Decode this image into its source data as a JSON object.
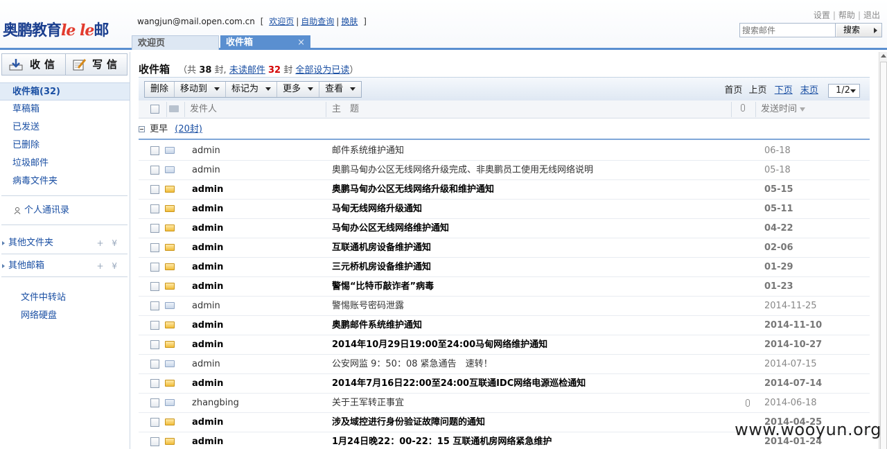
{
  "header": {
    "logo_main": "奥鹏教育",
    "logo_lele": "le le",
    "logo_suffix": "邮",
    "user_email": "wangjun@mail.open.com.cn",
    "links": {
      "welcome": "欢迎页",
      "self_query": "自助查询",
      "change_skin": "换肤"
    },
    "top_links": {
      "settings": "设置",
      "help": "帮助",
      "logout": "退出"
    },
    "search_placeholder": "搜索邮件",
    "search_button": "搜索"
  },
  "tabs": {
    "welcome": "欢迎页",
    "inbox": "收件箱",
    "close": "×"
  },
  "sidebar": {
    "receive": "收信",
    "write": "写信",
    "folders": [
      "收件箱(32)",
      "草稿箱",
      "已发送",
      "已删除",
      "垃圾邮件",
      "病毒文件夹"
    ],
    "contacts": "个人通讯录",
    "other_folders": "其他文件夹",
    "other_mailboxes": "其他邮箱",
    "group_actions": "+ ¥",
    "transfer": "文件中转站",
    "netdisk": "网络硬盘"
  },
  "list": {
    "title": "收件箱",
    "total_prefix": "（共",
    "total": "38",
    "total_unit": "封,",
    "unread_link": "未读邮件",
    "unread_count": "32",
    "unread_unit": "封",
    "mark_all": "全部设为已读",
    "close_paren": "）"
  },
  "toolbar": {
    "delete": "删除",
    "move_to": "移动到",
    "mark_as": "标记为",
    "more": "更多",
    "view": "查看",
    "pager_first": "首页",
    "pager_prev": "上页",
    "pager_next": "下页",
    "pager_last": "末页",
    "page_value": "1/2"
  },
  "columns": {
    "sender": "发件人",
    "subject": "主　题",
    "date": "发送时间"
  },
  "group": {
    "label": "更早",
    "count": "(20封)"
  },
  "colors": {
    "accent": "#5a8fd0",
    "link": "#1a4fa3",
    "unread_count": "#d40000"
  },
  "emails": [
    {
      "sender": "admin",
      "subject": "邮件系统维护通知",
      "date": "06-18",
      "unread": false,
      "attachment": false
    },
    {
      "sender": "admin",
      "subject": "奥鹏马甸办公区无线网络升级完成、非奥鹏员工使用无线网络说明",
      "date": "05-18",
      "unread": false,
      "attachment": false
    },
    {
      "sender": "admin",
      "subject": "奥鹏马甸办公区无线网络升级和维护通知",
      "date": "05-15",
      "unread": true,
      "attachment": false
    },
    {
      "sender": "admin",
      "subject": "马甸无线网络升级通知",
      "date": "05-11",
      "unread": true,
      "attachment": false
    },
    {
      "sender": "admin",
      "subject": "马甸办公区无线网络维护通知",
      "date": "04-22",
      "unread": true,
      "attachment": false
    },
    {
      "sender": "admin",
      "subject": "互联通机房设备维护通知",
      "date": "02-06",
      "unread": true,
      "attachment": false
    },
    {
      "sender": "admin",
      "subject": "三元桥机房设备维护通知",
      "date": "01-29",
      "unread": true,
      "attachment": false
    },
    {
      "sender": "admin",
      "subject": "警惕“比特币敲诈者”病毒",
      "date": "01-23",
      "unread": true,
      "attachment": false
    },
    {
      "sender": "admin",
      "subject": "警惕账号密码泄露",
      "date": "2014-11-25",
      "unread": false,
      "attachment": false
    },
    {
      "sender": "admin",
      "subject": "奥鹏邮件系统维护通知",
      "date": "2014-11-10",
      "unread": true,
      "attachment": false
    },
    {
      "sender": "admin",
      "subject": "2014年10月29日19:00至24:00马甸网络维护通知",
      "date": "2014-10-27",
      "unread": true,
      "attachment": false
    },
    {
      "sender": "admin",
      "subject": "公安网监 9：50：08 紧急通告　速转！",
      "date": "2014-07-15",
      "unread": false,
      "attachment": false
    },
    {
      "sender": "admin",
      "subject": "2014年7月16日22:00至24:00互联通IDC网络电源巡检通知",
      "date": "2014-07-14",
      "unread": true,
      "attachment": false
    },
    {
      "sender": "zhangbing",
      "subject": "关于王军转正事宜",
      "date": "2014-06-18",
      "unread": false,
      "attachment": true
    },
    {
      "sender": "admin",
      "subject": "涉及域控进行身份验证故障问题的通知",
      "date": "2014-04-25",
      "unread": true,
      "attachment": false
    },
    {
      "sender": "admin",
      "subject": "1月24日晚22：00-22：15 互联通机房网络紧急维护",
      "date": "2014-01-24",
      "unread": true,
      "attachment": false
    }
  ],
  "watermark": "www.wooyun.org"
}
